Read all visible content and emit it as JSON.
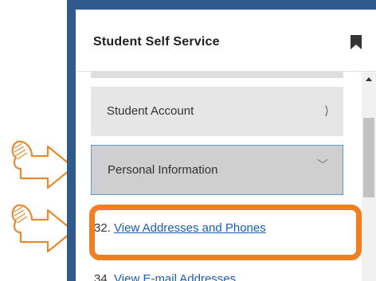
{
  "panel": {
    "title": "Student Self Service"
  },
  "menu": {
    "student_account": "Student Account",
    "student_account_chevron": "⟩",
    "personal_information": "Personal Information",
    "personal_information_chevron": "﹀"
  },
  "links": [
    {
      "number": "32.",
      "label": "View Addresses and Phones"
    },
    {
      "number": "34.",
      "label": "View E-mail Addresses"
    }
  ],
  "colors": {
    "frame_border": "#2f5b8c",
    "highlight_orange": "#f07f22",
    "link_blue": "#1a5fb4",
    "focus_border": "#5b9bd5"
  },
  "icons": [
    "bookmark-icon",
    "pointing-hand-icon",
    "chevron-right-icon",
    "chevron-down-icon",
    "scroll-up-arrow-icon"
  ]
}
